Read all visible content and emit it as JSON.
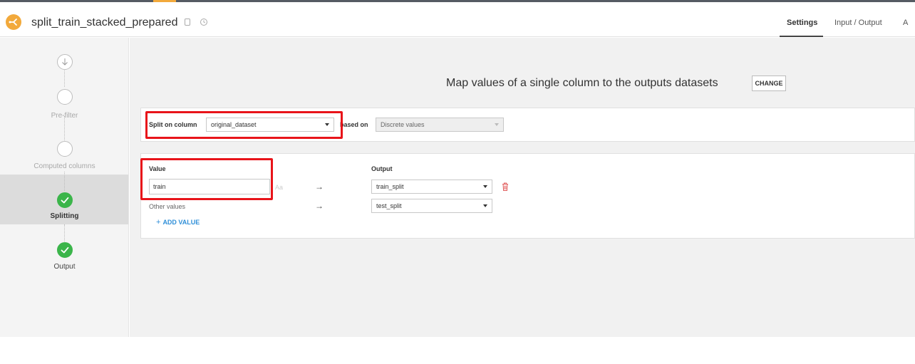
{
  "header": {
    "recipe_name": "split_train_stacked_prepared",
    "tabs": [
      {
        "label": "Settings",
        "active": true
      },
      {
        "label": "Input / Output",
        "active": false
      },
      {
        "label": "A",
        "active": false
      }
    ],
    "accent_color": "#f2a93b"
  },
  "sidebar": {
    "steps": [
      {
        "label": "",
        "state": "input"
      },
      {
        "label": "Pre-filter",
        "state": "empty"
      },
      {
        "label": "Computed columns",
        "state": "empty"
      },
      {
        "label": "Splitting",
        "state": "done",
        "current": true
      },
      {
        "label": "Output",
        "state": "done"
      }
    ],
    "done_color": "#3bb54a"
  },
  "main": {
    "mode_title": "Map values of a single column to the outputs datasets",
    "change_label": "CHANGE",
    "split": {
      "column_label": "Split on column",
      "column_value": "original_dataset",
      "based_on_label": "based on",
      "based_on_value": "Discrete values"
    },
    "mapping": {
      "value_header": "Value",
      "output_header": "Output",
      "rows": [
        {
          "value": "train",
          "case_hint": "Aa",
          "arrow": "→",
          "output": "train_split"
        },
        {
          "value": "Other values",
          "arrow": "→",
          "output": "test_split"
        }
      ],
      "add_label": "ADD VALUE",
      "add_icon": "+"
    }
  },
  "highlight_color": "#e8141a"
}
